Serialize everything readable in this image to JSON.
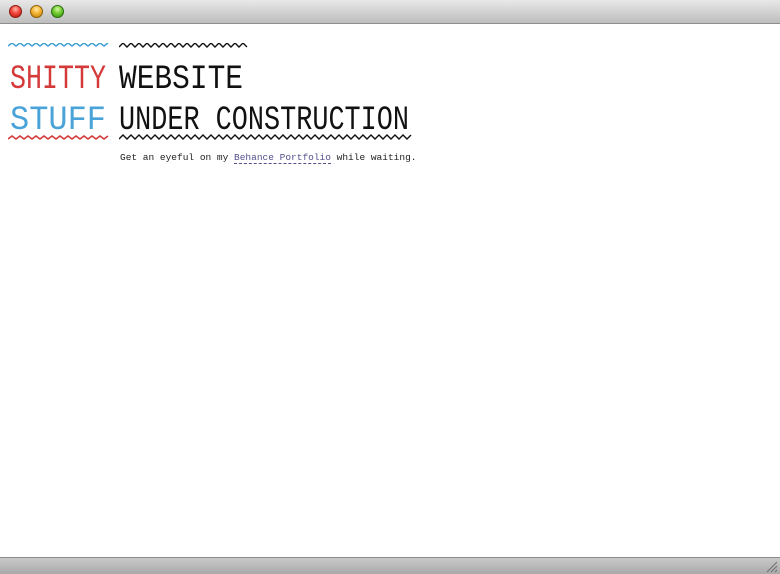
{
  "window": {
    "controls": {
      "close_icon": "close-icon",
      "minimize_icon": "minimize-icon",
      "zoom_icon": "zoom-icon"
    }
  },
  "logo": {
    "line1": "SHITTY",
    "line2": "STUFF",
    "line1_color": "#d43a3a",
    "line2_color": "#4aa3d8",
    "top_zigzag_color": "#4aa3d8",
    "bottom_zigzag_color": "#d43a3a"
  },
  "headline": {
    "line1": "WEBSITE",
    "line2": "UNDER CONSTRUCTION",
    "color": "#111111"
  },
  "tagline": {
    "prefix": "Get an eyeful on my ",
    "link_text": "Behance Portfolio",
    "suffix": " while waiting.",
    "link_color": "#53508a"
  }
}
